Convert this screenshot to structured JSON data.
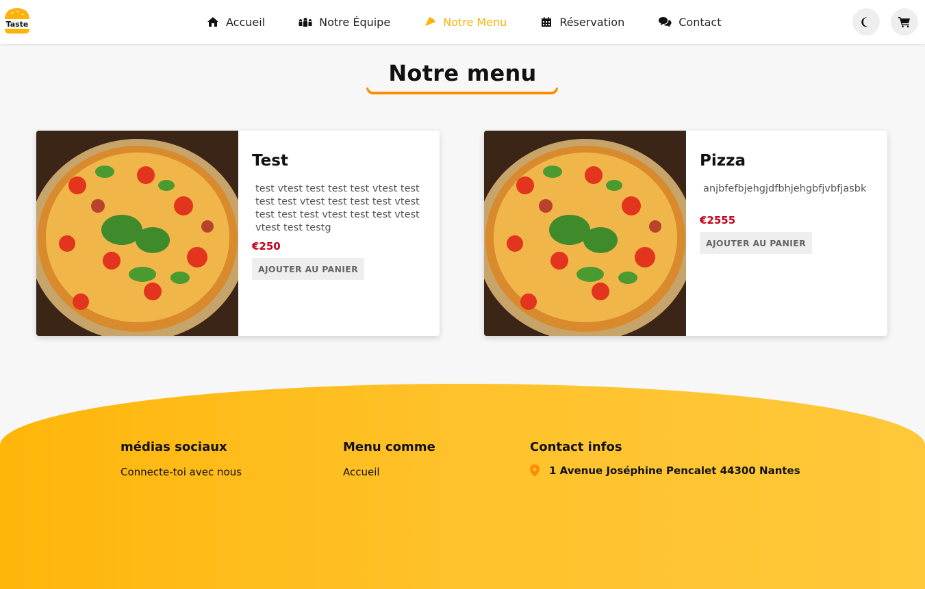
{
  "brand": {
    "logo_text": "Taste"
  },
  "nav": {
    "items": [
      {
        "label": "Accueil",
        "icon": "home-icon"
      },
      {
        "label": "Notre Équipe",
        "icon": "users-icon"
      },
      {
        "label": "Notre Menu",
        "icon": "pizza-icon",
        "active": true
      },
      {
        "label": "Réservation",
        "icon": "calendar-icon"
      },
      {
        "label": "Contact",
        "icon": "chat-icon"
      }
    ],
    "actions": [
      "dark-mode-toggle (moon-icon)",
      "cart (cart-icon)"
    ]
  },
  "page": {
    "title": "Notre menu"
  },
  "menu": {
    "items": [
      {
        "name": "Test",
        "description": "test vtest test test test vtest test test test vtest test test test vtest test test test vtest test test vtest vtest test testg",
        "price": "€250",
        "button_label": "AJOUTER AU PANIER"
      },
      {
        "name": "Pizza",
        "description": "anjbfefbjehgjdfbhjehgbfjvbfjasbk",
        "price": "€2555",
        "button_label": "AJOUTER AU PANIER"
      }
    ]
  },
  "footer": {
    "social": {
      "heading": "médias sociaux",
      "text": "Connecte-toi avec nous"
    },
    "menu": {
      "heading": "Menu comme",
      "first_link": "Accueil"
    },
    "contact": {
      "heading": "Contact infos",
      "address": "1 Avenue Joséphine Pencalet 44300 Nantes"
    }
  },
  "colors": {
    "accent": "#ffb20a",
    "underline": "#ff8c00",
    "price": "#c3001a",
    "footer": "#ffc22b"
  }
}
